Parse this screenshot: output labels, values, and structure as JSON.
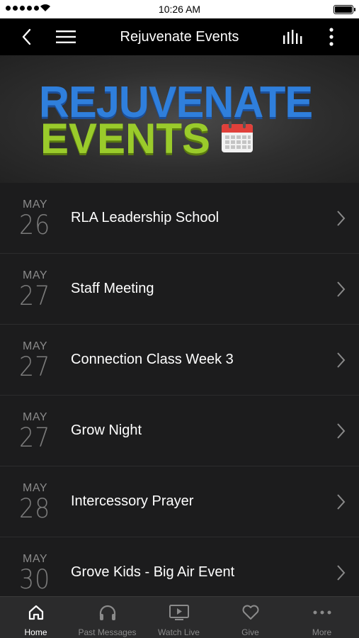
{
  "status_bar": {
    "time": "10:26 AM"
  },
  "nav": {
    "title": "Rejuvenate Events",
    "back_icon": "chevron-left-icon",
    "menu_icon": "hamburger-icon",
    "audio_icon": "audio-bars-icon",
    "more_icon": "vertical-dots-icon"
  },
  "banner": {
    "line1": "REJUVENATE",
    "line2": "EVENTS",
    "line1_color": "#2f7fdc",
    "line2_color": "#9acb2b",
    "calendar_icon": "calendar-icon"
  },
  "events": [
    {
      "month": "MAY",
      "day": "26",
      "title": "RLA Leadership School"
    },
    {
      "month": "MAY",
      "day": "27",
      "title": "Staff Meeting"
    },
    {
      "month": "MAY",
      "day": "27",
      "title": "Connection Class Week 3"
    },
    {
      "month": "MAY",
      "day": "27",
      "title": "Grow Night"
    },
    {
      "month": "MAY",
      "day": "28",
      "title": "Intercessory Prayer"
    },
    {
      "month": "MAY",
      "day": "30",
      "title": "Grove Kids - Big Air Event"
    }
  ],
  "tabs": [
    {
      "label": "Home",
      "icon": "home-icon",
      "active": true
    },
    {
      "label": "Past Messages",
      "icon": "headphones-icon",
      "active": false
    },
    {
      "label": "Watch Live",
      "icon": "tv-play-icon",
      "active": false
    },
    {
      "label": "Give",
      "icon": "heart-icon",
      "active": false
    },
    {
      "label": "More",
      "icon": "more-dots-icon",
      "active": false
    }
  ],
  "colors": {
    "background": "#000000",
    "list_background": "#1c1c1d",
    "tab_bar": "#2b2b2c",
    "muted_text": "#8a8a8a"
  }
}
